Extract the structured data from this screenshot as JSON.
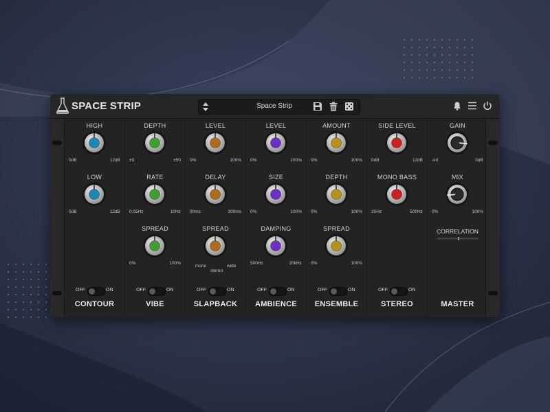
{
  "app": {
    "title": "SPACE STRIP"
  },
  "preset": {
    "name": "Space Strip"
  },
  "colors": {
    "panel": "#232323",
    "background": "#2a3146",
    "contour": "#1f86b8",
    "vibe": "#3f9f2e",
    "slapback": "#b06a1c",
    "ambience": "#6e2fc4",
    "ensemble": "#b8911c",
    "stereo": "#c82222",
    "master": "#2a2a2a"
  },
  "icons": {
    "logo": "flask-icon",
    "preset_arrows": "up-down-arrows-icon",
    "save": "save-icon",
    "delete": "trash-icon",
    "random": "dice-icon",
    "notifications": "bell-icon",
    "menu": "hamburger-menu-icon",
    "power": "power-icon"
  },
  "toggle": {
    "off": "OFF",
    "on": "ON"
  },
  "modules": [
    {
      "name": "CONTOUR",
      "color_key": "contour",
      "toggle_on": false,
      "knobs": [
        {
          "label": "HIGH",
          "min": "0dB",
          "max": "12dB",
          "value": 0.5
        },
        {
          "label": "LOW",
          "min": "0dB",
          "max": "12dB",
          "value": 0.5
        }
      ]
    },
    {
      "name": "VIBE",
      "color_key": "vibe",
      "toggle_on": false,
      "knobs": [
        {
          "label": "DEPTH",
          "min": "±0",
          "max": "±50",
          "value": 0.5
        },
        {
          "label": "RATE",
          "min": "0.05Hz",
          "max": "10Hz",
          "value": 0.5
        },
        {
          "label": "SPREAD",
          "min": "0%",
          "max": "100%",
          "value": 0.5
        }
      ]
    },
    {
      "name": "SLAPBACK",
      "color_key": "slapback",
      "toggle_on": false,
      "knobs": [
        {
          "label": "LEVEL",
          "min": "0%",
          "max": "100%",
          "value": 0.5
        },
        {
          "label": "DELAY",
          "min": "30ms",
          "max": "300ms",
          "value": 0.5
        },
        {
          "label": "SPREAD",
          "min": "mono",
          "max": "wide",
          "mid": "stereo",
          "value": 0.5
        }
      ]
    },
    {
      "name": "AMBIENCE",
      "color_key": "ambience",
      "toggle_on": false,
      "knobs": [
        {
          "label": "LEVEL",
          "min": "0%",
          "max": "100%",
          "value": 0.5
        },
        {
          "label": "SIZE",
          "min": "0%",
          "max": "100%",
          "value": 0.5
        },
        {
          "label": "DAMPING",
          "min": "500Hz",
          "max": "20kHz",
          "value": 0.5
        }
      ]
    },
    {
      "name": "ENSEMBLE",
      "color_key": "ensemble",
      "toggle_on": false,
      "knobs": [
        {
          "label": "AMOUNT",
          "min": "0%",
          "max": "100%",
          "value": 0.5
        },
        {
          "label": "DEPTH",
          "min": "0%",
          "max": "100%",
          "value": 0.5
        },
        {
          "label": "SPREAD",
          "min": "0%",
          "max": "100%",
          "value": 0.5
        }
      ]
    },
    {
      "name": "STEREO",
      "color_key": "stereo",
      "toggle_on": false,
      "knobs": [
        {
          "label": "SIDE LEVEL",
          "min": "0dB",
          "max": "12dB",
          "value": 0.5
        },
        {
          "label": "MONO BASS",
          "min": "20Hz",
          "max": "500Hz",
          "value": 0.5
        }
      ]
    },
    {
      "name": "MASTER",
      "color_key": "master",
      "knobs": [
        {
          "label": "GAIN",
          "min": "-inf",
          "max": "0dB",
          "value": 0.85
        },
        {
          "label": "MIX",
          "min": "0%",
          "max": "100%",
          "value": 0.15
        }
      ],
      "correlation": {
        "label": "CORRELATION",
        "value": 0.5
      }
    }
  ]
}
